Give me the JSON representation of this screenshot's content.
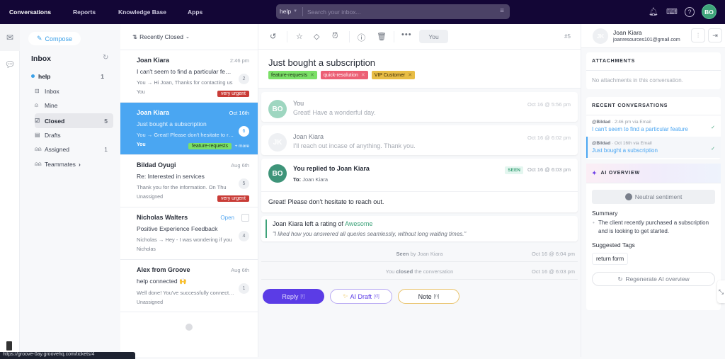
{
  "topbar": {
    "nav": [
      {
        "label": "Conversations",
        "active": true
      },
      {
        "label": "Reports",
        "active": false
      },
      {
        "label": "Knowledge Base",
        "active": false
      },
      {
        "label": "Apps",
        "active": false
      }
    ],
    "search": {
      "scope": "help",
      "placeholder": "Search your inbox..."
    },
    "avatar_initials": "BO",
    "icons": [
      "bell-icon",
      "keyboard-icon",
      "help-icon"
    ]
  },
  "folders": {
    "compose_label": "Compose",
    "title": "Inbox",
    "mailbox": {
      "label": "help",
      "count": "1"
    },
    "items": [
      {
        "label": "Inbox",
        "icon": "inbox-icon",
        "count": ""
      },
      {
        "label": "Mine",
        "icon": "user-icon",
        "count": ""
      },
      {
        "label": "Closed",
        "icon": "checkbox-icon",
        "count": "5",
        "active": true
      },
      {
        "label": "Drafts",
        "icon": "document-icon",
        "count": ""
      },
      {
        "label": "Assigned",
        "icon": "users-icon",
        "count": "1"
      },
      {
        "label": "Teammates",
        "icon": "users-icon",
        "count": "",
        "chevron": "›"
      }
    ]
  },
  "list": {
    "sort_label": "Recently Closed",
    "conversations": [
      {
        "name": "Joan Kiara",
        "time": "2:46 pm",
        "subject": "I can't seem to find a particular feature",
        "preview": "You → Hi Joan,   Thanks for contacting us",
        "assignee": "You",
        "count": "2",
        "tag": "very urgent"
      },
      {
        "name": "Joan Kiara",
        "time": "Oct 16th",
        "subject": "Just bought a subscription",
        "preview": "You → Great! Please don't hesitate to reach out.",
        "assignee": "You",
        "count": "6",
        "tag": "feature-requests",
        "more": "+ more"
      },
      {
        "name": "Bildad Oyugi",
        "time": "Aug 6th",
        "subject": "Re: Interested in services",
        "preview": "Thank you for the information.  On Thu",
        "assignee": "Unassigned",
        "count": "5",
        "tag": "very urgent"
      },
      {
        "name": "Nicholas Walters",
        "status": "Open",
        "subject": "Positive Experience Feedback",
        "preview": "Nicholas → Hey - I was wondering if you",
        "assignee": "Nicholas",
        "count": "4"
      },
      {
        "name": "Alex from Groove",
        "time": "Aug 6th",
        "subject": "help connected 🙌",
        "preview": "Well done! You've successfully connected",
        "assignee": "Unassigned",
        "count": "1"
      }
    ]
  },
  "conversation": {
    "ticket_number": "#5",
    "assign_label": "You",
    "title": "Just bought a subscription",
    "tags": [
      {
        "label": "feature-requests",
        "color": "#7be067"
      },
      {
        "label": "quick-resolution",
        "color": "#ec5f74"
      },
      {
        "label": "VIP Customer",
        "color": "#e8bd45"
      }
    ],
    "messages": [
      {
        "initials": "BO",
        "author": "You",
        "text": "Great! Have a wonderful day.",
        "time": "Oct 16 @ 5:56 pm"
      },
      {
        "initials": "JK",
        "author": "Joan Kiara",
        "text": "I'll reach out incase of anything. Thank you.",
        "time": "Oct 16 @ 6:02 pm"
      },
      {
        "initials": "BO",
        "author": "You replied to Joan Kiara",
        "to_label": "To:",
        "to": "Joan Kiara",
        "seen": "SEEN",
        "time": "Oct 16 @ 6:03 pm",
        "body": "Great! Please don't hesitate to reach out."
      }
    ],
    "rating": {
      "prefix": "Joan Kiara left a rating of",
      "value": "Awesome",
      "quote": "\"I liked how you answered all queries seamlessly, without long waiting times.\""
    },
    "events": [
      {
        "bold": "Seen",
        "text": "by Joan Kiara",
        "time": "Oct 16 @ 6:04 pm"
      },
      {
        "pre": "You",
        "bold": "closed",
        "text": "the conversation",
        "time": "Oct 16 @ 6:03 pm"
      }
    ],
    "actions": {
      "reply": "Reply",
      "reply_key": "[r]",
      "ai_draft": "AI Draft",
      "ai_key": "[d]",
      "note": "Note",
      "note_key": "[n]"
    }
  },
  "sidebar": {
    "contact": {
      "initials": "JK",
      "name": "Joan Kiara",
      "email": "joanresources101@gmail.com"
    },
    "attachments": {
      "title": "ATTACHMENTS",
      "empty": "No attachments in this conversation."
    },
    "recent": {
      "title": "RECENT CONVERSATIONS",
      "items": [
        {
          "user": "@Bildad",
          "meta": "· 2:46 pm via Email",
          "subject": "I can't seem to find a particular feature"
        },
        {
          "user": "@Bildad",
          "meta": "· Oct 16th via Email",
          "subject": "Just bought a subscription",
          "active": true
        }
      ]
    },
    "ai": {
      "title": "AI OVERVIEW",
      "sentiment": "Neutral sentiment",
      "summary_title": "Summary",
      "summary": "The client recently purchased a subscription and is looking to get started.",
      "tags_title": "Suggested Tags",
      "suggested_tags": [
        "return form"
      ],
      "regenerate": "Regenerate AI overview"
    }
  },
  "status_url": "https://groove-0ay.groovehq.com/tickets/4"
}
